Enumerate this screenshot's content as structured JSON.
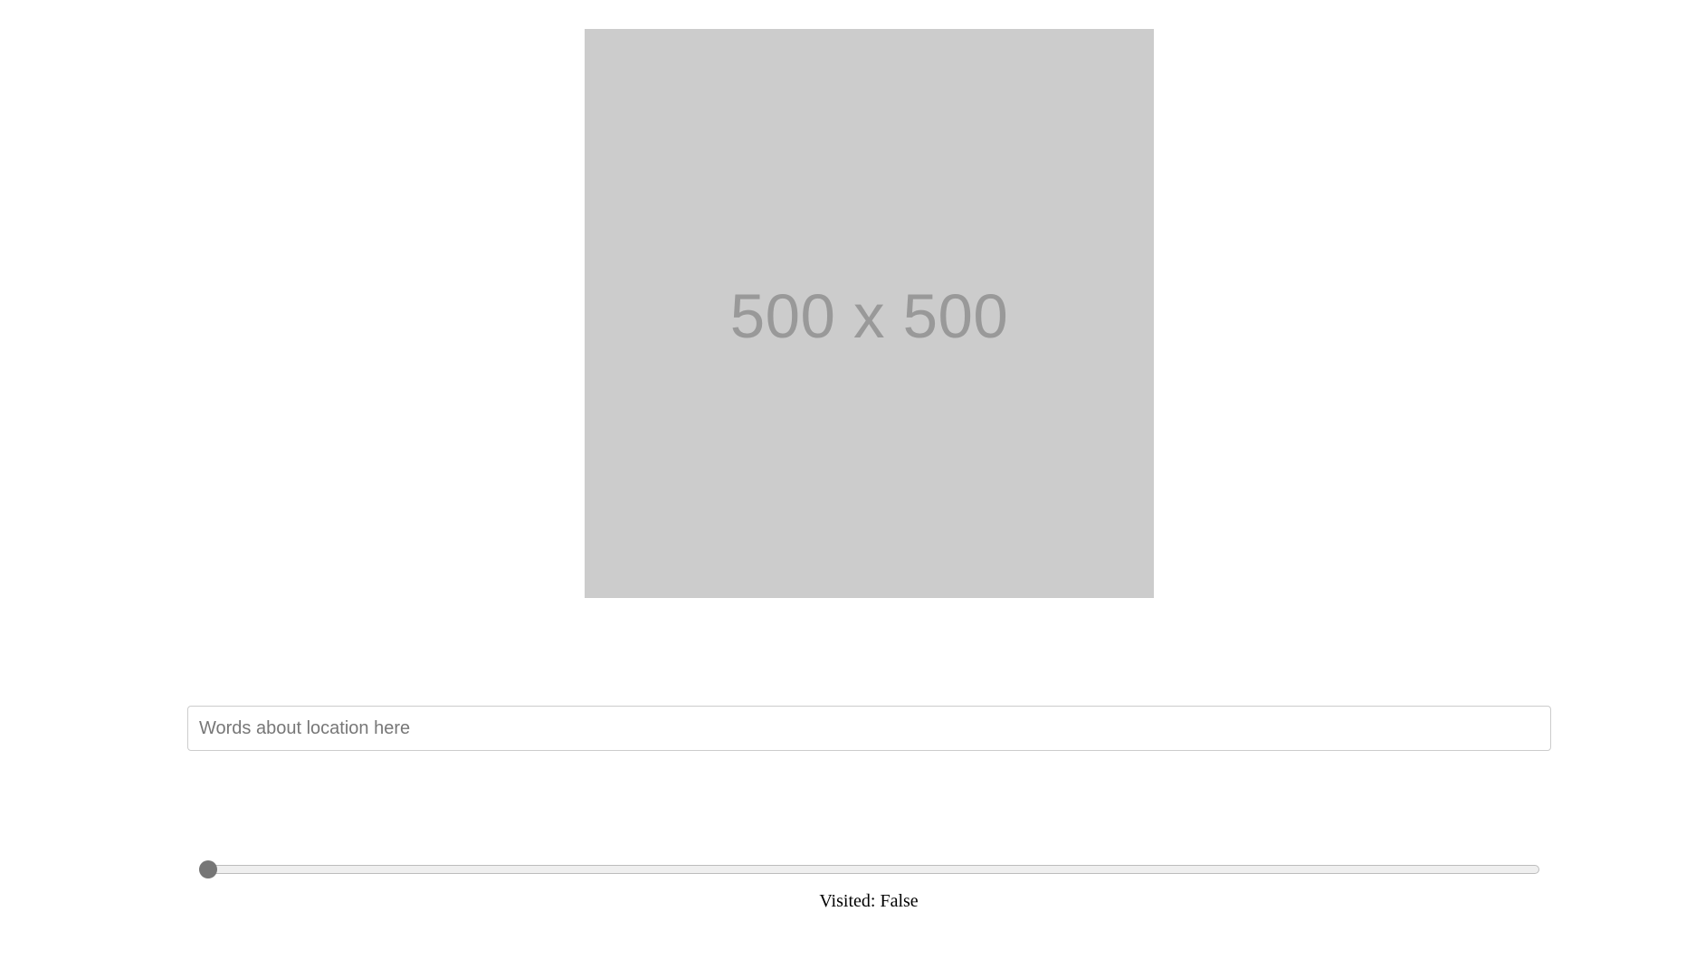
{
  "image": {
    "placeholder_text": "500 x 500",
    "background_color": "#cccccc",
    "text_color": "#999999"
  },
  "location_input": {
    "value": "",
    "placeholder": "Words about location here"
  },
  "slider": {
    "value_fraction": 0.0
  },
  "status": {
    "visited_text": "Visited: False"
  }
}
